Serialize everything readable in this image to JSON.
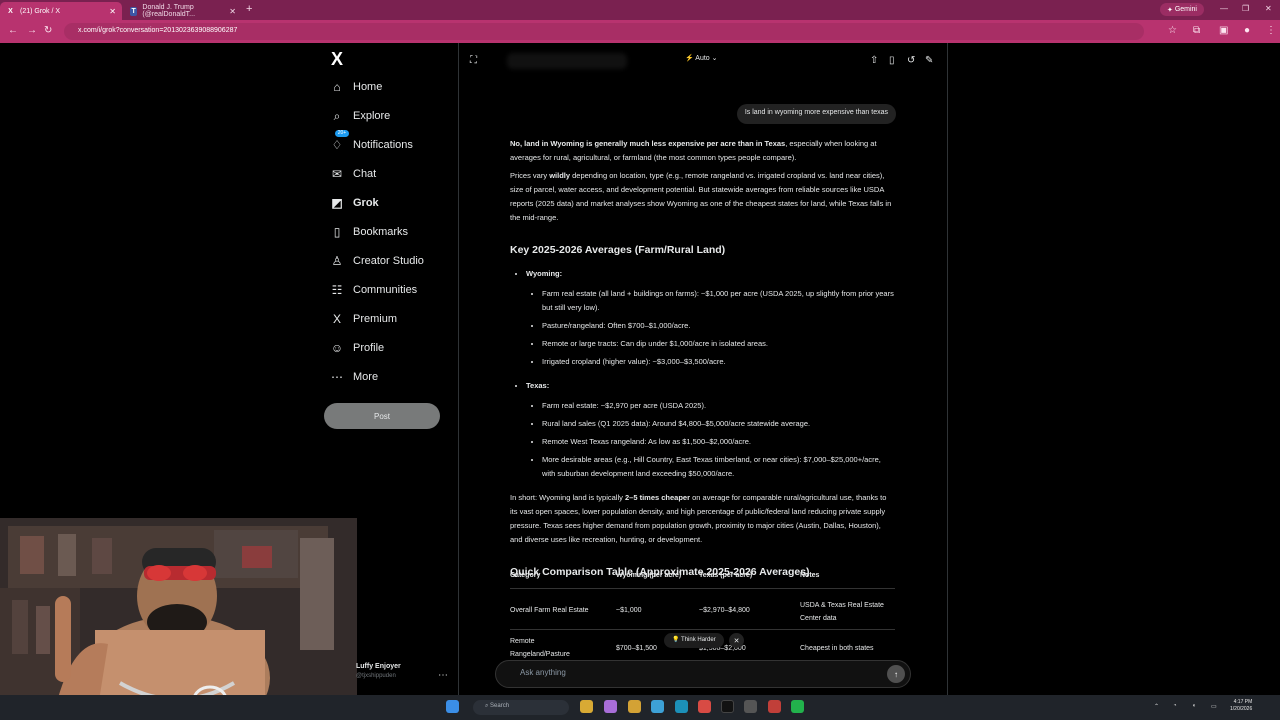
{
  "browser": {
    "tabs": [
      {
        "label": "(21) Grok / X",
        "favicon": "X"
      },
      {
        "label": "Donald J. Trump (@realDonaldT...",
        "favicon": "T"
      }
    ],
    "gemini_label": "Gemini",
    "url": "x.com/i/grok?conversation=2013023639088906287"
  },
  "sidebar": {
    "logo": "X",
    "notification_badge": "20+",
    "items": [
      {
        "label": "Home",
        "icon": "home-icon",
        "glyph": "⌂"
      },
      {
        "label": "Explore",
        "icon": "search-icon",
        "glyph": "⌕"
      },
      {
        "label": "Notifications",
        "icon": "bell-icon",
        "glyph": "♢"
      },
      {
        "label": "Chat",
        "icon": "mail-icon",
        "glyph": "✉"
      },
      {
        "label": "Grok",
        "icon": "grok-icon",
        "glyph": "◩"
      },
      {
        "label": "Bookmarks",
        "icon": "bookmark-icon",
        "glyph": "▯"
      },
      {
        "label": "Creator Studio",
        "icon": "creator-icon",
        "glyph": "♙"
      },
      {
        "label": "Communities",
        "icon": "communities-icon",
        "glyph": "☷"
      },
      {
        "label": "Premium",
        "icon": "premium-icon",
        "glyph": "X"
      },
      {
        "label": "Profile",
        "icon": "profile-icon",
        "glyph": "☺"
      },
      {
        "label": "More",
        "icon": "more-icon",
        "glyph": "⋯"
      }
    ],
    "post_label": "Post",
    "user_name": "Luffy Enjoyer",
    "user_handle": "@tjxshippuden"
  },
  "grok": {
    "mode": "Auto",
    "question": "Is land in wyoming more expensive than texas",
    "intro_bold": "No, land in Wyoming is generally much less expensive per acre than in Texas",
    "intro_rest": ", especially when looking at averages for rural, agricultural, or farmland (the most common types people compare).",
    "prices_prefix": "Prices vary ",
    "prices_bold": "wildly",
    "prices_rest": " depending on location, type (e.g., remote rangeland vs. irrigated cropland vs. land near cities), size of parcel, water access, and development potential. But statewide averages from reliable sources like USDA reports (2025 data) and market analyses show Wyoming as one of the cheapest states for land, while Texas falls in the mid-range.",
    "heading_averages": "Key 2025-2026 Averages (Farm/Rural Land)",
    "wyoming_label": "Wyoming:",
    "wyoming_items": [
      "Farm real estate (all land + buildings on farms): ~$1,000 per acre (USDA 2025, up slightly from prior years but still very low).",
      "Pasture/rangeland: Often $700–$1,000/acre.",
      "Remote or large tracts: Can dip under $1,000/acre in isolated areas.",
      "Irrigated cropland (higher value): ~$3,000–$3,500/acre."
    ],
    "texas_label": "Texas:",
    "texas_items": [
      "Farm real estate: ~$2,970 per acre (USDA 2025).",
      "Rural land sales (Q1 2025 data): Around $4,800–$5,000/acre statewide average.",
      "Remote West Texas rangeland: As low as $1,500–$2,000/acre.",
      "More desirable areas (e.g., Hill Country, East Texas timberland, or near cities): $7,000–$25,000+/acre, with suburban development land exceeding $50,000/acre."
    ],
    "short_prefix": "In short: Wyoming land is typically ",
    "short_bold": "2–5 times cheaper",
    "short_rest": " on average for comparable rural/agricultural use, thanks to its vast open spaces, lower population density, and high percentage of public/federal land reducing private supply pressure. Texas sees higher demand from population growth, proximity to major cities (Austin, Dallas, Houston), and diverse uses like recreation, hunting, or development.",
    "heading_table": "Quick Comparison Table (Approximate 2025-2026 Averages)",
    "table_headers": [
      "Category",
      "Wyoming (per acre)",
      "Texas (per acre)",
      "Notes"
    ],
    "table_rows": [
      {
        "category": "Overall Farm Real Estate",
        "wyoming": "~$1,000",
        "texas": "~$2,970–$4,800",
        "notes": "USDA & Texas Real Estate Center data"
      },
      {
        "category": "Remote Rangeland/Pasture",
        "wyoming": "$700–$1,500",
        "texas": "$1,500–$2,000",
        "notes": "Cheapest in both states"
      }
    ],
    "think_harder": "Think Harder",
    "ask_placeholder": "Ask anything"
  },
  "taskbar": {
    "search_label": "Search",
    "time": "4:17 PM",
    "date": "1/20/2026"
  }
}
